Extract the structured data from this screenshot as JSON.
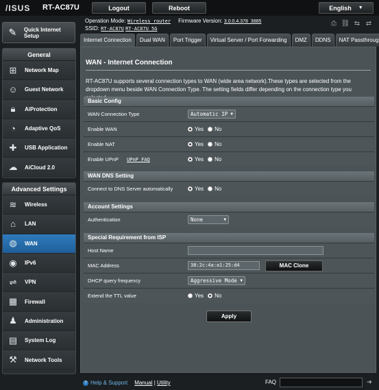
{
  "header": {
    "logo": "/ISUS",
    "model": "RT-AC87U",
    "logout_label": "Logout",
    "reboot_label": "Reboot",
    "language": "English"
  },
  "info": {
    "op_mode_label": "Operation Mode:",
    "op_mode_value": "Wireless router",
    "fw_label": "Firmware Version:",
    "fw_value": "3.0.0.4.378_3885",
    "ssid_label": "SSID:",
    "ssid_24": "RT-AC87U",
    "ssid_5": "RT-AC87U_5G"
  },
  "sidebar": {
    "qis_label": "Quick Internet Setup",
    "general_title": "General",
    "general_items": [
      "Network Map",
      "Guest Network",
      "AiProtection",
      "Adaptive QoS",
      "USB Application",
      "AiCloud 2.0"
    ],
    "advanced_title": "Advanced Settings",
    "advanced_items": [
      "Wireless",
      "LAN",
      "WAN",
      "IPv6",
      "VPN",
      "Firewall",
      "Administration",
      "System Log",
      "Network Tools"
    ]
  },
  "tabs": [
    "Internet Connection",
    "Dual WAN",
    "Port Trigger",
    "Virtual Server / Port Forwarding",
    "DMZ",
    "DDNS",
    "NAT Passthrough"
  ],
  "page": {
    "title": "WAN - Internet Connection",
    "description": "RT-AC87U supports several connection types to WAN (wide area network).These types are selected from the dropdown menu beside WAN Connection Type. The setting fields differ depending on the connection type you selected."
  },
  "basic": {
    "title": "Basic Config",
    "wan_type_label": "WAN Connection Type",
    "wan_type_value": "Automatic IP",
    "enable_wan_label": "Enable WAN",
    "enable_nat_label": "Enable NAT",
    "enable_upnp_label": "Enable UPnP",
    "upnp_faq": "UPnP FAQ"
  },
  "dns": {
    "title": "WAN DNS Setting",
    "auto_label": "Connect to DNS Server automatically"
  },
  "account": {
    "title": "Account Settings",
    "auth_label": "Authentication",
    "auth_value": "None"
  },
  "isp": {
    "title": "Special Requirement from ISP",
    "host_label": "Host Name",
    "host_value": "",
    "mac_label": "MAC Address",
    "mac_value": "38:2c:4a:a1:25:d4",
    "mac_clone": "MAC Clone",
    "dhcp_label": "DHCP query frequency",
    "dhcp_value": "Aggressive Mode",
    "ttl_label": "Extend the TTL value"
  },
  "radio": {
    "yes": "Yes",
    "no": "No"
  },
  "apply_label": "Apply",
  "footer": {
    "help": "Help & Support",
    "manual": "Manual",
    "sep": " | ",
    "utility": "Utility",
    "faq": "FAQ"
  }
}
